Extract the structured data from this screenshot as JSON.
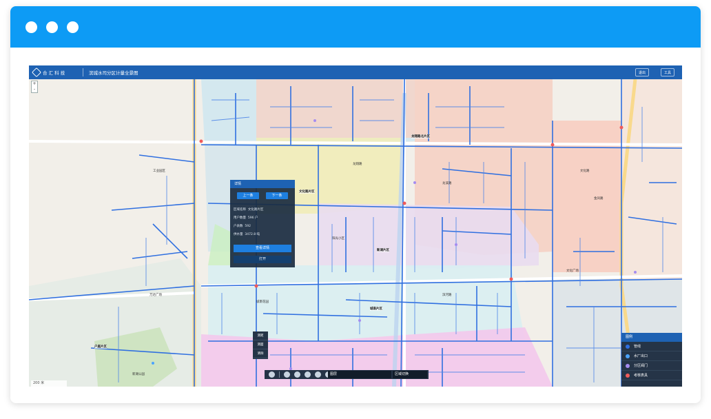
{
  "window": {
    "dots": 3,
    "chrome_color": "#0d9bf5"
  },
  "app": {
    "logo_text": "合 汇 科 技",
    "title": "滨城水司分区计量全景图",
    "top_buttons": [
      "退出",
      "工具"
    ]
  },
  "map": {
    "zoom": [
      "+",
      "-"
    ],
    "scale_text": "200 米",
    "labels": [
      {
        "text": "龙翔路",
        "style": "plain"
      },
      {
        "text": "龙溪路",
        "style": "plain"
      },
      {
        "text": "文化路",
        "style": "plain"
      },
      {
        "text": "金凤路",
        "style": "plain"
      },
      {
        "text": "工业园区",
        "style": "plain"
      },
      {
        "text": "城南花园",
        "style": "plain"
      },
      {
        "text": "阳光小区",
        "style": "plain"
      },
      {
        "text": "滨河路",
        "style": "plain"
      },
      {
        "text": "文化广场",
        "style": "plain"
      },
      {
        "text": "万达广场",
        "style": "plain"
      },
      {
        "text": "新湖公园",
        "style": "plain"
      }
    ],
    "area_labels": [
      "文化路片区",
      "龙翔路北片区",
      "新湖片区",
      "城南片区",
      "户庭片区"
    ]
  },
  "popup": {
    "title": "详情",
    "prev": "上一条",
    "next": "下一条",
    "rows": [
      {
        "label": "区域名称",
        "value": "文化路片区"
      },
      {
        "label": "用户数量",
        "value": "596 户"
      },
      {
        "label": "户表数",
        "value": "592"
      },
      {
        "label": "供水量",
        "value": "3472.8 吨"
      }
    ],
    "detail_button": "查看详情",
    "open_button": "打开"
  },
  "vtools": [
    "测距",
    "测面",
    "清除"
  ],
  "toolbar": {
    "layer_label": "图层",
    "select_label": "区域切换"
  },
  "legend": {
    "title": "图例",
    "items": [
      {
        "label": "管线",
        "color": "#2f6fe0"
      },
      {
        "label": "水厂出口",
        "color": "#4aa3ff"
      },
      {
        "label": "分区阀门",
        "color": "#a58cf0"
      },
      {
        "label": "考核表具",
        "color": "#ef5b5b"
      }
    ]
  }
}
